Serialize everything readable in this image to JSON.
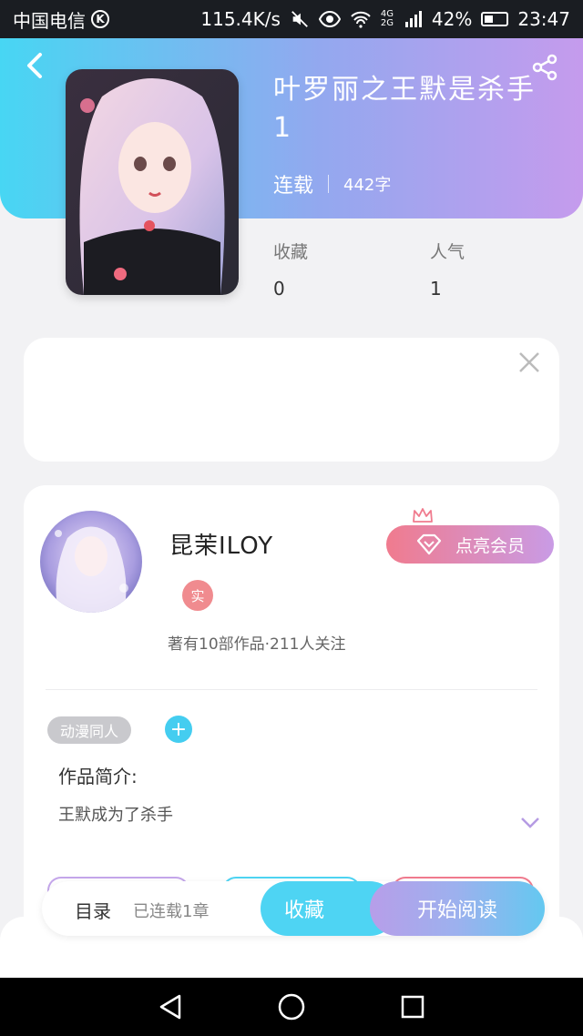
{
  "status_bar": {
    "carrier": "中国电信",
    "carrier_badge": "K",
    "speed": "115.4K/s",
    "network": "4G 2G",
    "battery": "42%",
    "battery_level": 0.42,
    "time": "23:47"
  },
  "book": {
    "title": "叶罗丽之王默是杀手1",
    "status": "连载",
    "word_count": "442字",
    "stats": [
      {
        "label": "收藏",
        "value": "0"
      },
      {
        "label": "人气",
        "value": "1"
      }
    ]
  },
  "author": {
    "name": "昆茉ILOY",
    "real_badge": "实",
    "summary": "著有10部作品·211人关注",
    "vip_label": "点亮会员"
  },
  "work": {
    "tag": "动漫同人",
    "add_tag": "+",
    "intro_label": "作品简介:",
    "intro_text": "王默成为了杀手"
  },
  "action_bar": {
    "toc_label": "目录",
    "chapters_label": "已连载1章",
    "favorite_label": "收藏",
    "read_label": "开始阅读"
  },
  "colors": {
    "header_gradient_start": "#47d6f3",
    "header_gradient_end": "#c59bed",
    "accent_cyan": "#4ed4f3",
    "vip_pink": "#f07b8e"
  },
  "icons": [
    "back-icon",
    "share-icon",
    "close-icon",
    "diamond-icon",
    "crown-icon",
    "chevron-down-icon",
    "nav-back-icon",
    "nav-home-icon",
    "nav-recents-icon",
    "wifi-icon",
    "eye-icon",
    "mute-icon",
    "signal-icon"
  ]
}
